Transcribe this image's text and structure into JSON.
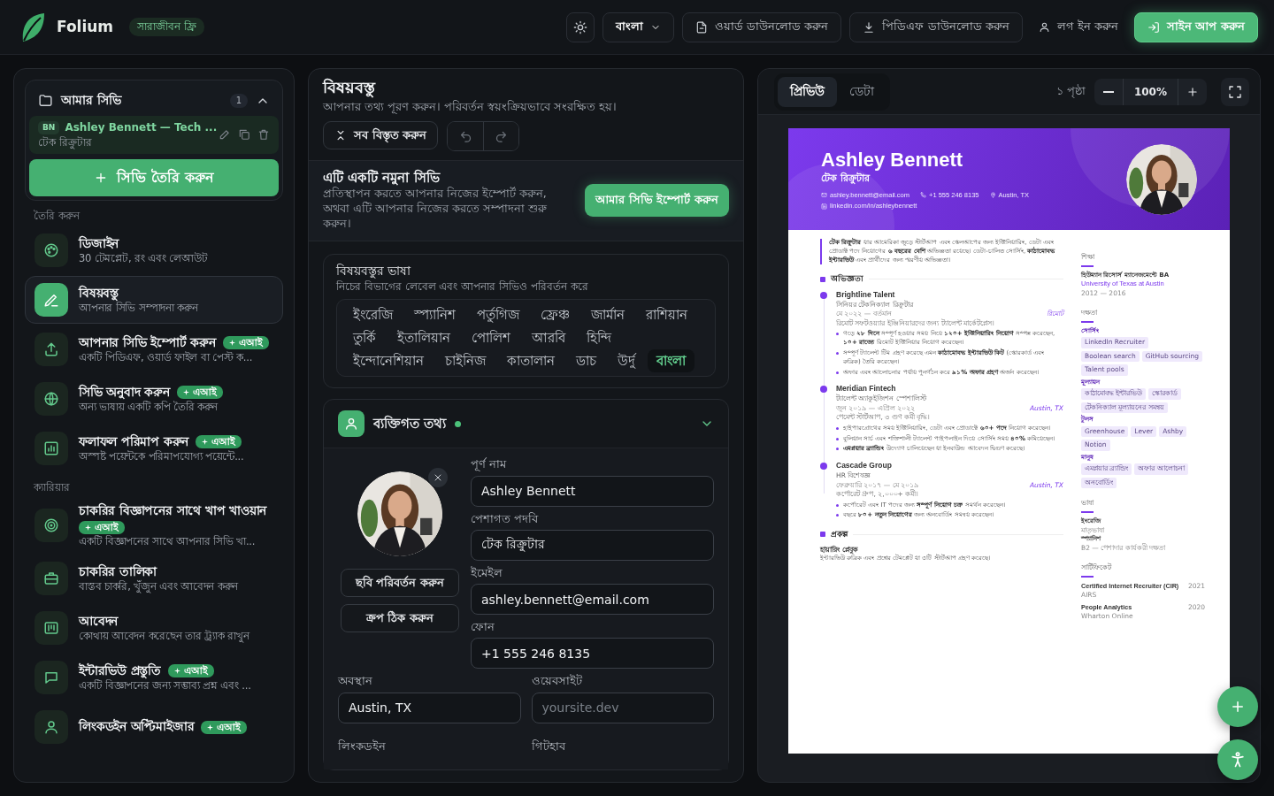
{
  "topbar": {
    "logo": "Folium",
    "badge": "সারাজীবন ফ্রি",
    "language": "বাংলা",
    "word_download": "ওয়ার্ড ডাউনলোড করুন",
    "pdf_download": "পিডিএফ ডাউনলোড করুন",
    "login": "লগ ইন করুন",
    "signup": "সাইন আপ করুন"
  },
  "sidebar": {
    "my_cv": {
      "title": "আমার সিভি",
      "count": "1",
      "expanded": true,
      "items": [
        {
          "initials": "BN",
          "name": "Ashley Bennett — Tech ...",
          "role": "টেক রিক্রুটার",
          "selected": true
        }
      ]
    },
    "create_button": "সিভি তৈরি করুন",
    "sections": [
      {
        "heading": "তৈরি করুন",
        "items": [
          {
            "title": "ডিজাইন",
            "subtitle": "30 টেমপ্লেট, রং এবং লেআউট",
            "ai": false,
            "selected": false
          },
          {
            "title": "বিষয়বস্তু",
            "subtitle": "আপনার সিভি সম্পাদনা করুন",
            "ai": false,
            "selected": true
          },
          {
            "title": "আপনার সিভি ইম্পোর্ট করুন",
            "badge": "এআই",
            "ai": true,
            "subtitle": "একটি পিডিএফ, ওয়ার্ড ফাইল বা পেস্ট ক...",
            "selected": false
          },
          {
            "title": "সিভি অনুবাদ করুন",
            "badge": "এআই",
            "ai": true,
            "subtitle": "অন্য ভাষায় একটি কপি তৈরি করুন",
            "selected": false
          },
          {
            "title": "ফলাফল পরিমাপ করুন",
            "badge": "এআই",
            "ai": true,
            "subtitle": "অস্পষ্ট পয়েন্টকে পরিমাপযোগ্য পয়েন্টে...",
            "selected": false
          }
        ]
      },
      {
        "heading": "ক্যারিয়ার",
        "items": [
          {
            "title": "চাকরির বিজ্ঞাপনের সাথে খাপ খাওয়ান",
            "badge": "এআই",
            "ai": true,
            "subtitle": "একটি বিজ্ঞাপনের সাথে আপনার সিভি খা...",
            "selected": false
          },
          {
            "title": "চাকরির তালিকা",
            "subtitle": "বাস্তব চাকরি, খুঁজুন এবং আবেদন করুন",
            "ai": false,
            "selected": false
          },
          {
            "title": "আবেদন",
            "subtitle": "কোথায় আবেদন করেছেন তার ট্র্যাক রাখুন",
            "ai": false,
            "selected": false
          },
          {
            "title": "ইন্টারভিউ প্রস্তুতি",
            "badge": "এআই",
            "ai": true,
            "subtitle": "একটি বিজ্ঞাপনের জন্য সম্ভাব্য প্রশ্ন এবং ...",
            "selected": false
          },
          {
            "title": "লিংকডইন অপ্টিমাইজার",
            "badge": "এআই",
            "ai": true,
            "selected": false
          }
        ]
      }
    ]
  },
  "editor": {
    "title": "বিষয়বস্তু",
    "subtitle": "আপনার তথ্য পূরণ করুন। পরিবর্তন স্বয়ংক্রিয়ভাবে সংরক্ষিত হয়।",
    "expand_all": "সব বিস্তৃত করুন",
    "sample": {
      "title": "এটি একটি নমুনা সিভি",
      "text": "প্রতিস্থাপন করতে আপনার নিজের ইম্পোর্ট করুন, অথবা এটি আপনার নিজের করতে সম্পাদনা শুরু করুন।",
      "button": "আমার সিভি ইম্পোর্ট করুন"
    },
    "content_language": {
      "title": "বিষয়বস্তুর ভাষা",
      "subtitle": "নিচের বিভাগের লেবেল এবং আপনার সিভিও পরিবর্তন করে",
      "options": [
        {
          "label": "ইংরেজি",
          "selected": false
        },
        {
          "label": "স্প্যানিশ",
          "selected": false
        },
        {
          "label": "পর্তুগিজ",
          "selected": false
        },
        {
          "label": "ফ্রেঞ্চ",
          "selected": false
        },
        {
          "label": "জার্মান",
          "selected": false
        },
        {
          "label": "রাশিয়ান",
          "selected": false
        },
        {
          "label": "তুর্কি",
          "selected": false
        },
        {
          "label": "ইতালিয়ান",
          "selected": false
        },
        {
          "label": "পোলিশ",
          "selected": false
        },
        {
          "label": "আরবি",
          "selected": false
        },
        {
          "label": "হিন্দি",
          "selected": false
        },
        {
          "label": "ইন্দোনেশিয়ান",
          "selected": false
        },
        {
          "label": "চাইনিজ",
          "selected": false
        },
        {
          "label": "কাতালান",
          "selected": false
        },
        {
          "label": "ডাচ",
          "selected": false
        },
        {
          "label": "উর্দু",
          "selected": false
        },
        {
          "label": "বাংলা",
          "selected": true
        }
      ]
    },
    "personal_info": {
      "title": "ব্যক্তিগত তথ্য",
      "complete": true,
      "expanded": true,
      "photo": {
        "kind": "picture"
      },
      "change_photo": "ছবি পরিবর্তন করুন",
      "fix_crop": "ক্রপ ঠিক করুন",
      "fields": [
        {
          "label": "পূর্ণ নাম",
          "value": "Ashley Bennett"
        },
        {
          "label": "পেশাগত পদবি",
          "value": "টেক রিক্রুটার"
        },
        {
          "label": "ইমেইল",
          "value": "ashley.bennett@email.com"
        },
        {
          "label": "ফোন",
          "value": "+1 555 246 8135"
        }
      ],
      "pair_fields": [
        {
          "label": "অবস্থান",
          "value": "Austin, TX"
        },
        {
          "label": "ওয়েবসাইট",
          "placeholder": "yoursite.dev"
        }
      ],
      "cut_labels": [
        "লিংকডইন",
        "গিটহাব"
      ]
    }
  },
  "preview": {
    "tabs": [
      {
        "label": "প্রিভিউ",
        "selected": true
      },
      {
        "label": "ডেটা",
        "selected": false
      }
    ],
    "pages": "১ পৃষ্ঠা",
    "zoom": "100%",
    "cv": {
      "name": "Ashley Bennett",
      "title": "টেক রিক্রুটার",
      "email": "ashley.bennett@email.com",
      "phone": "+1 555 246 8135",
      "location": "Austin, TX",
      "linkedin": "linkedin.com/in/ashleybennett",
      "photo": {
        "kind": "picture"
      },
      "summary": "**টেক রিক্রুটার** যার আমেরিকা জুড়ে স্টার্টআপ এবং স্কেলআপের জন্য ইঞ্জিনিয়ারিং, ডেটা এবং প্রোডাক্ট পদে নিয়োগের **৬ বছরের বেশি** অভিজ্ঞতা রয়েছে। ডেটা-চালিত সোর্সিং, **কাঠামোবদ্ধ ইন্টারভিউ** এবং প্রার্থীদের জন্য স্মরণীয় অভিজ্ঞতা।",
      "experience_heading": "অভিজ্ঞতা",
      "jobs": [
        {
          "company": "Brightline Talent",
          "role": "সিনিয়র টেকনিক্যাল রিক্রুটার",
          "dates": "মে ২০২২ — বর্তমান",
          "location": "রিমোট",
          "description": "রিমোট সফটওয়্যার ইঞ্জিনিয়ারদের জন্য ট্যালেন্ট মার্কেটপ্লেস।",
          "bullets": [
            "গড়ে **২৮ দিনে** সম্পূর্ণ হওয়ার সময় নিয়ে **১২০+ ইঞ্জিনিয়ারিং নিয়োগ** সম্পন্ন করেছেন, **১০+ রাজ্যে** রিমোট ইঞ্জিনিয়ার নিয়োগ করেছেন।",
            "সম্পূর্ণ ট্যালেন্ট টিম গ্রহণ করেছে এমন **কাঠামোবদ্ধ ইন্টারভিউ কিট** (স্কোরকার্ড এবং রুব্রিক) তৈরি করেছেন।",
            "অফার এবং আলোচনার পর্যায় পুনর্গঠন করে **৯১% অফার গ্রহণ** অর্জন করেছেন।"
          ]
        },
        {
          "company": "Meridian Fintech",
          "role": "ট্যালেন্ট অ্যাকুইজিশন স্পেশালিস্ট",
          "dates": "জুন ২০১৯ — এপ্রিল ২০২২",
          "location": "Austin, TX",
          "description": "পেমেন্ট স্টার্টআপ, ৩ গুণ কর্মী বৃদ্ধি।",
          "bullets": [
            "হাইপারগ্রোথের সময় ইঞ্জিনিয়ারিং, ডেটা এবং প্রোডাক্টে **৬০+ পদে** নিয়োগ করেছেন।",
            "বুলিয়ান সার্চ এবং শক্তিশালী ট্যালেন্ট পাইপলাইন দিয়ে সোর্সিং সময় **৪০%** কমিয়েছেন।",
            "**এমপ্লয়ার ব্র্যান্ডিং** উদ্যোগ চালিয়েছেন যা ইনবাউন্ড আবেদন দ্বিগুণ করেছে।"
          ]
        },
        {
          "company": "Cascade Group",
          "role": "HR বিশেষজ্ঞ",
          "dates": "ফেব্রুয়ারি ২০১৭ — মে ২০১৯",
          "location": "Austin, TX",
          "description": "কর্পোরেট গ্রুপ, ২,০০০+ কর্মী।",
          "bullets": [
            "কর্পোরেট এবং IT পদের জন্য **সম্পূর্ণ নিয়োগ চক্র** সমর্থন করেছেন।",
            "বছরে **৮০+ নতুন নিয়োগের** জন্য অনবোর্ডিং সমন্বয় করেছেন।"
          ]
        }
      ],
      "projects_heading": "প্রকল্প",
      "projects": [
        {
          "name": "হায়ারিং প্লেবুক",
          "description": "ইন্টারভিউ রুব্রিক এবং প্রশ্নের টেমপ্লেট যা ৩টি স্টার্টআপ গ্রহণ করেছে।"
        }
      ],
      "education": {
        "heading": "শিক্ষা",
        "degree": "হিউম্যান রিসোর্স ম্যানেজমেন্টে BA",
        "school": "University of Texas at Austin",
        "years": "2012 — 2016"
      },
      "skills": {
        "heading": "দক্ষতা",
        "groups": [
          {
            "name": "সোর্সিং",
            "tags": [
              "LinkedIn Recruiter",
              "Boolean search",
              "GitHub sourcing",
              "Talent pools"
            ]
          },
          {
            "name": "মূল্যায়ন",
            "tags": [
              "কাঠামোবদ্ধ ইন্টারভিউ",
              "স্কোরকার্ড",
              "টেকনিক্যাল মূল্যায়নের সমন্বয়"
            ]
          },
          {
            "name": "টুলস",
            "tags": [
              "Greenhouse",
              "Lever",
              "Ashby",
              "Notion"
            ]
          },
          {
            "name": "মানুষ",
            "tags": [
              "এমপ্লয়ার ব্র্যান্ডিং",
              "অফার আলোচনা",
              "অনবোর্ডিং"
            ]
          }
        ]
      },
      "languages": {
        "heading": "ভাষা",
        "items": [
          {
            "name": "ইংরেজি",
            "level": "মাতৃভাষা"
          },
          {
            "name": "স্প্যানিশ",
            "level": "B2 — পেশাদার কার্যকরী দক্ষতা"
          }
        ]
      },
      "certificates": {
        "heading": "সার্টিফিকেট",
        "items": [
          {
            "name": "Certified Internet Recruiter (CIR)",
            "issuer": "AIRS",
            "year": "2021"
          },
          {
            "name": "People Analytics",
            "issuer": "Wharton Online",
            "year": "2020"
          }
        ]
      }
    }
  }
}
